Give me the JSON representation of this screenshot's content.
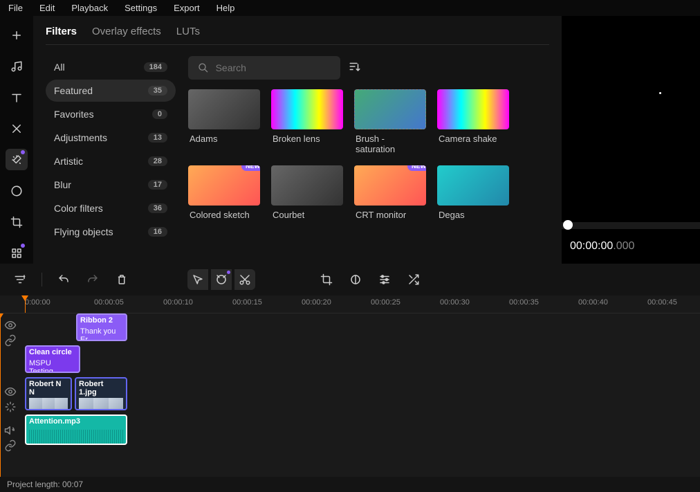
{
  "menu": [
    "File",
    "Edit",
    "Playback",
    "Settings",
    "Export",
    "Help"
  ],
  "left_tools": [
    {
      "name": "plus-icon",
      "glyph": "plus"
    },
    {
      "name": "music-icon",
      "glyph": "music"
    },
    {
      "name": "text-icon",
      "glyph": "text"
    },
    {
      "name": "transition-icon",
      "glyph": "transition"
    },
    {
      "name": "effects-icon",
      "glyph": "wand",
      "active": true,
      "dot": true
    },
    {
      "name": "mask-icon",
      "glyph": "mask"
    },
    {
      "name": "crop-icon",
      "glyph": "crop"
    },
    {
      "name": "apps-icon",
      "glyph": "grid",
      "dot": true
    }
  ],
  "tabs": {
    "items": [
      "Filters",
      "Overlay effects",
      "LUTs"
    ],
    "active": 0
  },
  "categories": [
    {
      "label": "All",
      "count": 184
    },
    {
      "label": "Featured",
      "count": 35,
      "active": true
    },
    {
      "label": "Favorites",
      "count": 0
    },
    {
      "label": "Adjustments",
      "count": 13
    },
    {
      "label": "Artistic",
      "count": 28
    },
    {
      "label": "Blur",
      "count": 17
    },
    {
      "label": "Color filters",
      "count": 36
    },
    {
      "label": "Flying objects",
      "count": 16
    }
  ],
  "search": {
    "placeholder": "Search"
  },
  "filters": [
    {
      "label": "Adams",
      "thumb": ""
    },
    {
      "label": "Broken lens",
      "thumb": "rainbow"
    },
    {
      "label": "Brush - saturation",
      "thumb": "blue",
      "dashed": true
    },
    {
      "label": "Camera shake",
      "thumb": "rainbow"
    },
    {
      "label": "Colored sketch",
      "thumb": "orange",
      "new": true
    },
    {
      "label": "Courbet",
      "thumb": ""
    },
    {
      "label": "CRT monitor",
      "thumb": "orange",
      "new": true
    },
    {
      "label": "Degas",
      "thumb": "teal"
    }
  ],
  "new_badge": "NEW",
  "preview": {
    "timecode": "00:00:00",
    "ms": ".000"
  },
  "ruler": [
    "0:00:00",
    "00:00:05",
    "00:00:10",
    "00:00:15",
    "00:00:20",
    "00:00:25",
    "00:00:30",
    "00:00:35",
    "00:00:40",
    "00:00:45"
  ],
  "clips": {
    "title1": {
      "l1": "Ribbon 2",
      "l2": "Thank you Er"
    },
    "title2": {
      "l1": "Clean circle",
      "l2": "MSPU Testing"
    },
    "media1": {
      "l1": "Robert  N N"
    },
    "media2": {
      "l1": "Robert 1.jpg"
    },
    "audio": {
      "l1": "Attention.mp3"
    }
  },
  "status": "Project length: 00:07"
}
